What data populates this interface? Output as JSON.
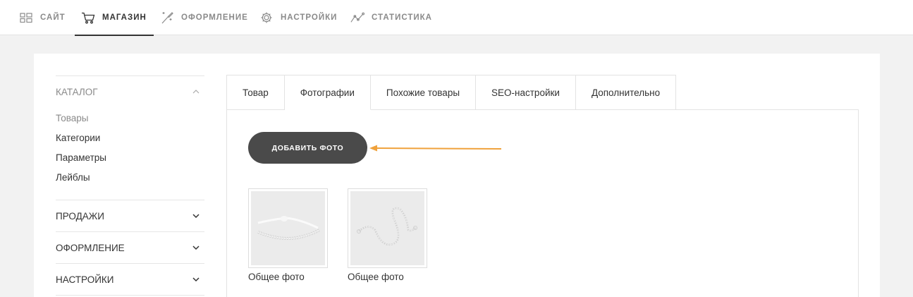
{
  "topnav": {
    "items": [
      {
        "label": "САЙТ",
        "icon": "grid-icon"
      },
      {
        "label": "МАГАЗИН",
        "icon": "cart-icon",
        "active": true
      },
      {
        "label": "ОФОРМЛЕНИЕ",
        "icon": "magic-wand-icon"
      },
      {
        "label": "НАСТРОЙКИ",
        "icon": "gear-icon"
      },
      {
        "label": "СТАТИСТИКА",
        "icon": "chart-line-icon"
      }
    ]
  },
  "sidebar": {
    "catalog": {
      "title": "КАТАЛОГ",
      "items": [
        "Товары",
        "Категории",
        "Параметры",
        "Лейблы"
      ]
    },
    "sales": "ПРОДАЖИ",
    "design": "ОФОРМЛЕНИЕ",
    "settings": "НАСТРОЙКИ"
  },
  "tabs": [
    "Товар",
    "Фотографии",
    "Похожие товары",
    "SEO-настройки",
    "Дополнительно"
  ],
  "active_tab": "Фотографии",
  "panel": {
    "add_button": "ДОБАВИТЬ ФОТО",
    "photos": [
      {
        "caption": "Общее фото"
      },
      {
        "caption": "Общее фото"
      }
    ]
  },
  "colors": {
    "accent_arrow": "#f0a23c",
    "button_bg": "#4a4a4a"
  }
}
